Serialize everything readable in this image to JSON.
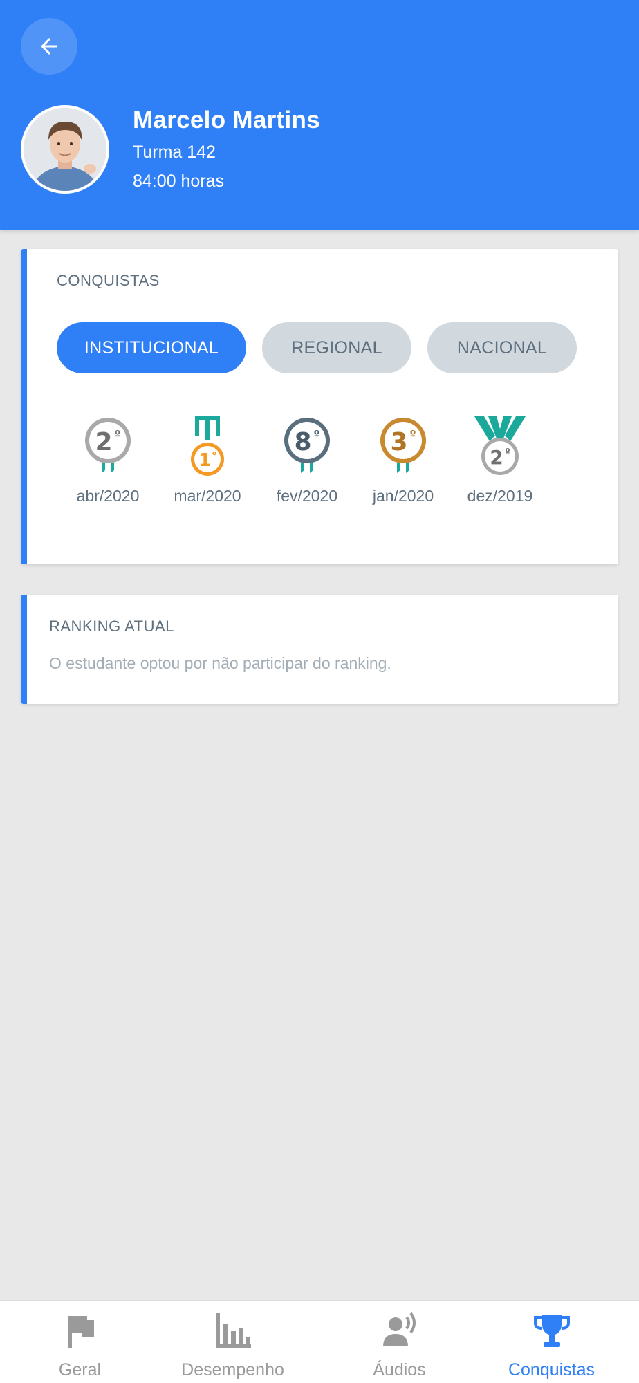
{
  "profile": {
    "name": "Marcelo Martins",
    "class_label": "Turma 142",
    "hours": "84:00 horas"
  },
  "achievements": {
    "title": "CONQUISTAS",
    "tabs": [
      {
        "label": "INSTITUCIONAL",
        "active": true
      },
      {
        "label": "REGIONAL",
        "active": false
      },
      {
        "label": "NACIONAL",
        "active": false
      }
    ],
    "medals": [
      {
        "rank": "2",
        "date": "abr/2020",
        "ring_color": "#a9a9a9",
        "ribbon_color": "#1aa99b"
      },
      {
        "rank": "1",
        "date": "mar/2020",
        "ring_color": "#f49a22",
        "ribbon_color": "#1aa99b"
      },
      {
        "rank": "8",
        "date": "fev/2020",
        "ring_color": "#5a6f7e",
        "ribbon_color": "#1aa99b"
      },
      {
        "rank": "3",
        "date": "jan/2020",
        "ring_color": "#c8892f",
        "ribbon_color": "#1aa99b"
      },
      {
        "rank": "2",
        "date": "dez/2019",
        "ring_color": "#a9a9a9",
        "ribbon_color": "#1aa99b"
      }
    ]
  },
  "ranking": {
    "title": "RANKING ATUAL",
    "message": "O estudante optou por não participar do ranking."
  },
  "nav": {
    "items": [
      {
        "label": "Geral",
        "icon": "flag-icon",
        "active": false
      },
      {
        "label": "Desempenho",
        "icon": "bar-chart-icon",
        "active": false
      },
      {
        "label": "Áudios",
        "icon": "speaker-icon",
        "active": false
      },
      {
        "label": "Conquistas",
        "icon": "trophy-icon",
        "active": true
      }
    ]
  },
  "colors": {
    "primary": "#2f80f6",
    "background": "#e8e8e8",
    "chip_inactive": "#d2d9de",
    "text_muted": "#5e6f7e",
    "nav_inactive": "#9a9a9a"
  }
}
